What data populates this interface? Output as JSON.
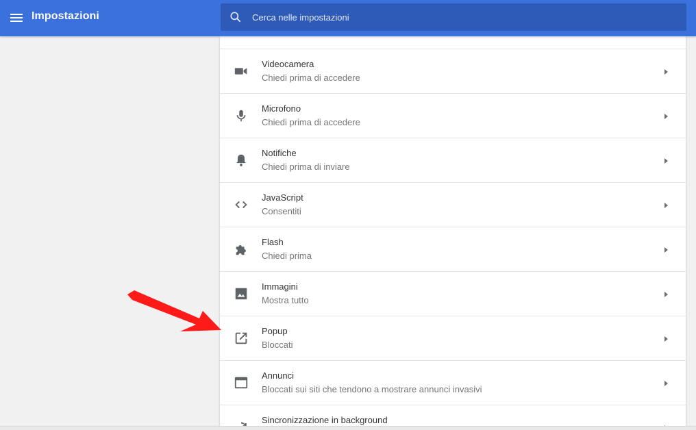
{
  "header": {
    "title": "Impostazioni",
    "search_placeholder": "Cerca nelle impostazioni"
  },
  "colors": {
    "header_bg": "#3b71dc",
    "search_bg": "#2f5bb8",
    "icon_gray": "#5f6368",
    "annotation_arrow": "#ff1a1a"
  },
  "settings": {
    "items": [
      {
        "icon": "videocam-icon",
        "title": "Videocamera",
        "subtitle": "Chiedi prima di accedere"
      },
      {
        "icon": "microphone-icon",
        "title": "Microfono",
        "subtitle": "Chiedi prima di accedere"
      },
      {
        "icon": "bell-icon",
        "title": "Notifiche",
        "subtitle": "Chiedi prima di inviare"
      },
      {
        "icon": "code-icon",
        "title": "JavaScript",
        "subtitle": "Consentiti"
      },
      {
        "icon": "puzzle-icon",
        "title": "Flash",
        "subtitle": "Chiedi prima"
      },
      {
        "icon": "image-icon",
        "title": "Immagini",
        "subtitle": "Mostra tutto"
      },
      {
        "icon": "open-in-new-icon",
        "title": "Popup",
        "subtitle": "Bloccati"
      },
      {
        "icon": "window-icon",
        "title": "Annunci",
        "subtitle": "Bloccati sui siti che tendono a mostrare annunci invasivi"
      },
      {
        "icon": "sync-icon",
        "title": "Sincronizzazione in background",
        "subtitle": ""
      }
    ]
  }
}
